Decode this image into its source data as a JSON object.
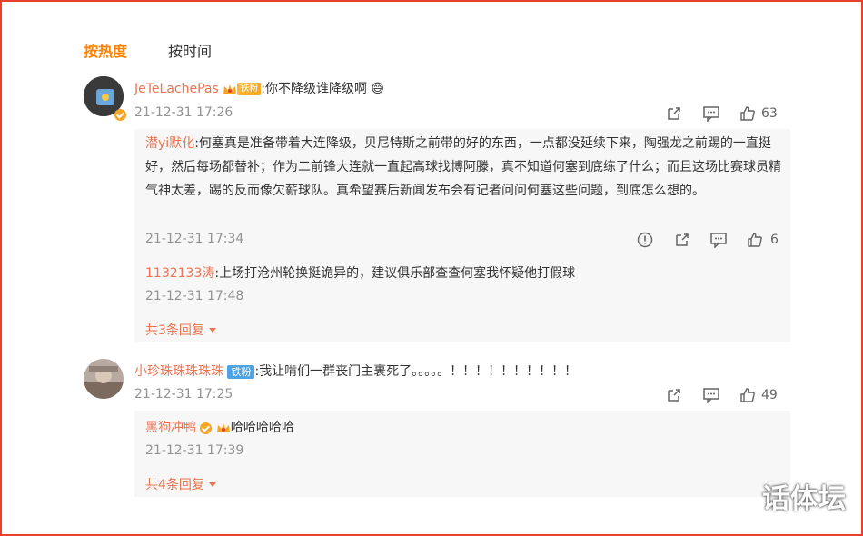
{
  "tabs": {
    "hot": "按热度",
    "time": "按时间"
  },
  "comments": [
    {
      "user": "JeTeLachePas",
      "badge": "铁粉",
      "text": ":你不降级谁降级啊",
      "emoji": "😅",
      "time": "21-12-31 17:26",
      "likes": "63",
      "replies": [
        {
          "user": "潜yi默化",
          "text": ":何塞真是准备带着大连降级，贝尼特斯之前带的好的东西，一点都没延续下来，陶强龙之前踢的一直挺好，然后每场都替补；作为二前锋大连就一直起高球找博阿滕，真不知道何塞到底练了什么；而且这场比赛球员精气神太差，踢的反而像欠薪球队。真希望赛后新闻发布会有记者问问何塞这些问题，到底怎么想的。",
          "time": "21-12-31 17:34",
          "likes": "6"
        },
        {
          "user": "1132133涛",
          "text": ":上场打沧州轮换挺诡异的，建议俱乐部查查何塞我怀疑他打假球",
          "time": "21-12-31 17:48"
        }
      ],
      "more": "共3条回复"
    },
    {
      "user": "小珍珠珠珠珠珠",
      "badge": "铁粉",
      "text": ":我让啃们一群丧门主裹死了。。。。。！！！！！！！！！！",
      "time": "21-12-31 17:25",
      "likes": "49",
      "replies": [
        {
          "user": "黑狗冲鸭",
          "text": "哈哈哈哈哈",
          "time": "21-12-31 17:39"
        }
      ],
      "more": "共4条回复"
    }
  ],
  "watermark": "话体坛"
}
